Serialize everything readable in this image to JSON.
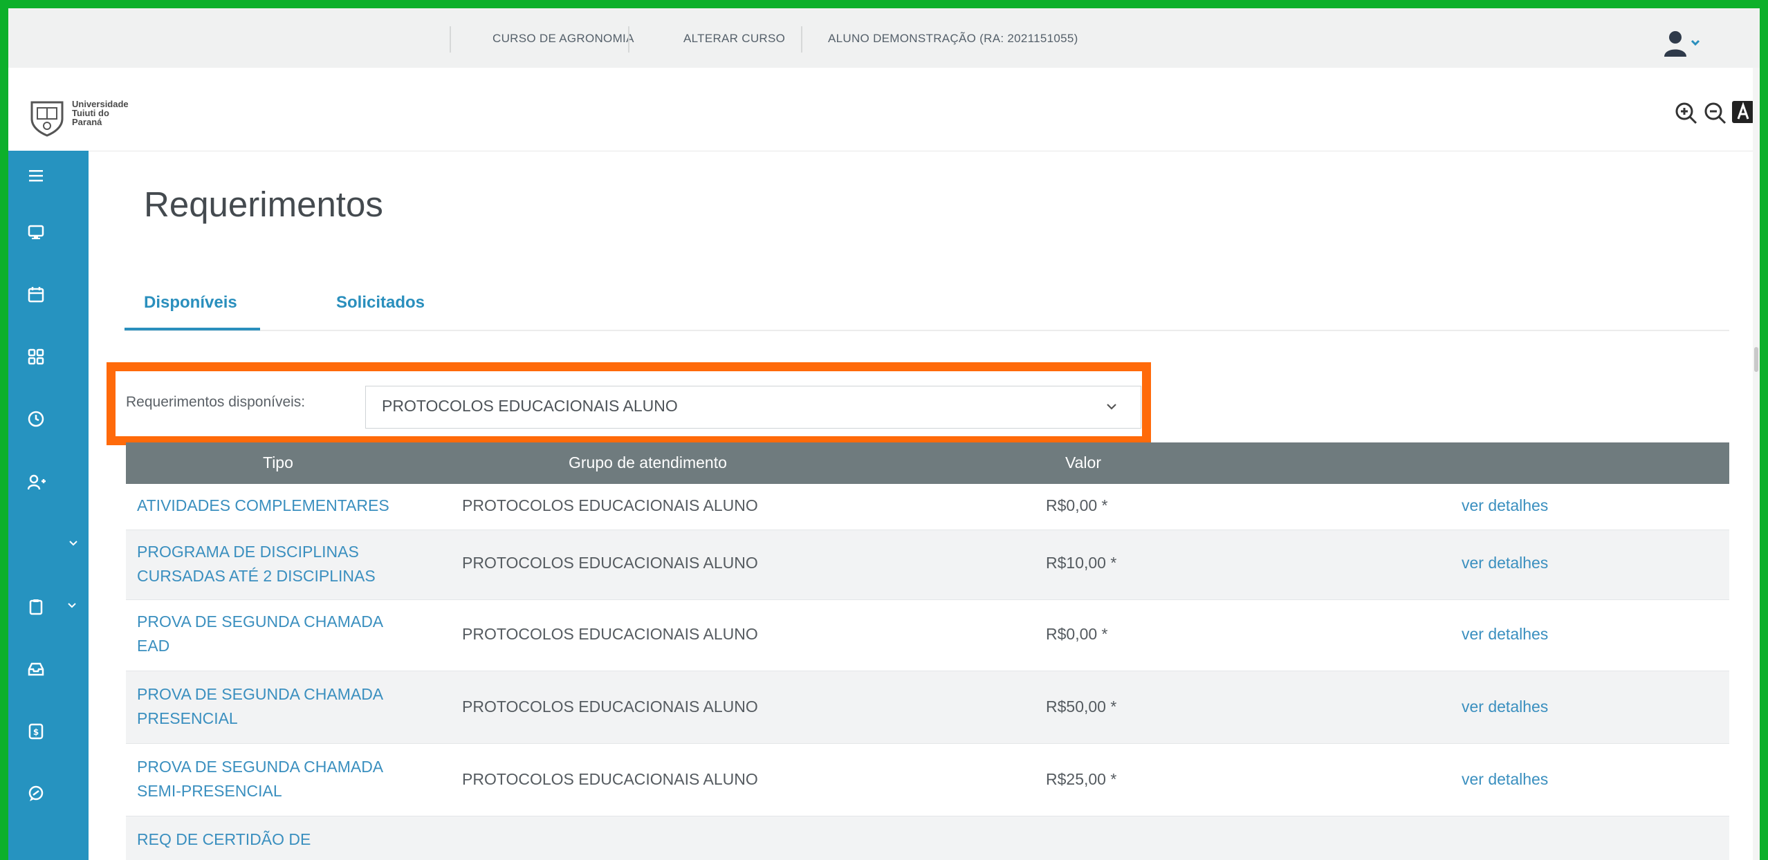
{
  "topbar": {
    "course": "CURSO DE AGRONOMIA",
    "change_course": "ALTERAR CURSO",
    "student": "ALUNO DEMONSTRAÇÃO (RA: 2021151055)"
  },
  "header": {
    "logo_text": [
      "Universidade",
      "Tuiuti do",
      "Paraná"
    ]
  },
  "page": {
    "title": "Requerimentos",
    "tabs": [
      {
        "label": "Disponíveis",
        "active": true
      },
      {
        "label": "Solicitados",
        "active": false
      }
    ]
  },
  "filter": {
    "label": "Requerimentos disponíveis:",
    "selected": "PROTOCOLOS EDUCACIONAIS ALUNO"
  },
  "table": {
    "headers": [
      "Tipo",
      "Grupo de atendimento",
      "Valor",
      ""
    ],
    "rows": [
      {
        "tipo_lines": [
          "ATIVIDADES COMPLEMENTARES"
        ],
        "grupo": "PROTOCOLOS EDUCACIONAIS ALUNO",
        "valor": "R$0,00 *",
        "link": "ver detalhes"
      },
      {
        "tipo_lines": [
          "PROGRAMA DE DISCIPLINAS",
          "CURSADAS ATÉ 2 DISCIPLINAS"
        ],
        "grupo": "PROTOCOLOS EDUCACIONAIS ALUNO",
        "valor": "R$10,00 *",
        "link": "ver detalhes"
      },
      {
        "tipo_lines": [
          "PROVA DE SEGUNDA CHAMADA",
          "EAD"
        ],
        "grupo": "PROTOCOLOS EDUCACIONAIS ALUNO",
        "valor": "R$0,00 *",
        "link": "ver detalhes"
      },
      {
        "tipo_lines": [
          "PROVA DE SEGUNDA CHAMADA",
          "PRESENCIAL"
        ],
        "grupo": "PROTOCOLOS EDUCACIONAIS ALUNO",
        "valor": "R$50,00 *",
        "link": "ver detalhes"
      },
      {
        "tipo_lines": [
          "PROVA DE SEGUNDA CHAMADA",
          "SEMI-PRESENCIAL"
        ],
        "grupo": "PROTOCOLOS EDUCACIONAIS ALUNO",
        "valor": "R$25,00 *",
        "link": "ver detalhes"
      },
      {
        "tipo_lines": [
          "REQ DE CERTIDÃO DE"
        ],
        "grupo": "",
        "valor": "",
        "link": ""
      }
    ]
  },
  "sidebar": {
    "items": [
      {
        "icon": "menu-icon"
      },
      {
        "icon": "monitor-icon"
      },
      {
        "icon": "calendar-icon"
      },
      {
        "icon": "grid-icon"
      },
      {
        "icon": "clock-icon"
      },
      {
        "icon": "add-user-icon"
      },
      {
        "icon": "chevron-down-icon"
      },
      {
        "icon": "clipboard-icon"
      },
      {
        "icon": "inbox-icon"
      },
      {
        "icon": "finance-icon"
      },
      {
        "icon": "chat-icon"
      }
    ]
  },
  "colors": {
    "border_green": "#0db02b",
    "sidebar": "#2693c0",
    "accent_blue": "#2a8fbd",
    "table_header": "#6f7b7e",
    "highlight": "#ff6a0a"
  }
}
